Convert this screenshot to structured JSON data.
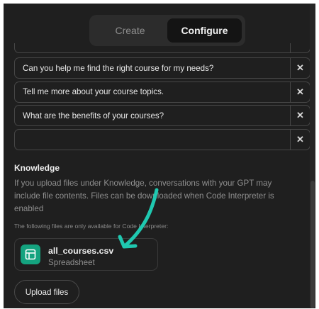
{
  "tabs": [
    {
      "label": "Create",
      "active": false
    },
    {
      "label": "Configure",
      "active": true
    }
  ],
  "conversation_starters": [
    {
      "value": "Can you help me find the right course for my needs?"
    },
    {
      "value": "Tell me more about your course topics."
    },
    {
      "value": "What are the benefits of your courses?"
    },
    {
      "value": ""
    }
  ],
  "close_glyph": "✕",
  "knowledge": {
    "title": "Knowledge",
    "description": "If you upload files under Knowledge, conversations with your GPT may include file contents. Files can be downloaded when Code Interpreter is enabled",
    "note": "The following files are only available for Code Interpreter:",
    "file": {
      "name": "all_courses.csv",
      "type": "Spreadsheet",
      "icon": "spreadsheet-icon"
    },
    "upload_label": "Upload files"
  },
  "colors": {
    "background": "#1f1f1f",
    "accent_teal": "#1fc8b0",
    "file_icon_bg": "#14a37f"
  }
}
